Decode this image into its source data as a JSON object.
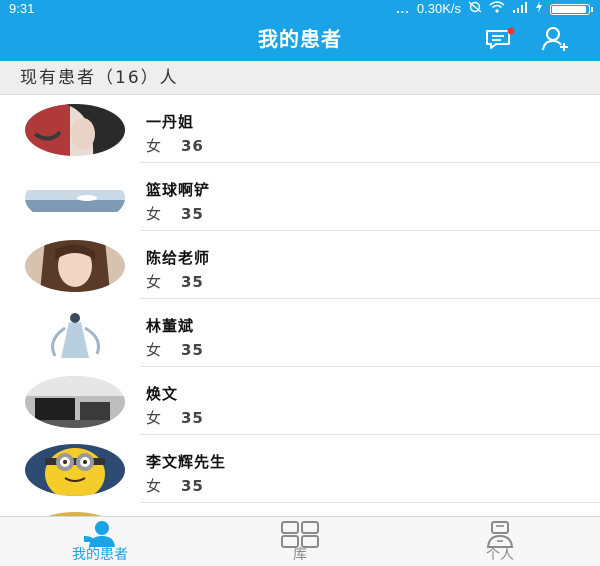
{
  "status_bar": {
    "time": "9:31",
    "signal_dots": "...",
    "network_speed": "0.30K/s"
  },
  "header": {
    "title": "我的患者",
    "message_icon": "chat-notification-icon",
    "add_icon": "add-user-icon",
    "background_color": "#1aa3e6"
  },
  "summary": {
    "text": "现有患者（16）人"
  },
  "patients": [
    {
      "name": "一丹姐",
      "gender": "女",
      "age": "36",
      "avatar": "avatar-dark-art"
    },
    {
      "name": "篮球啊铲",
      "gender": "女",
      "age": "35",
      "avatar": "avatar-sky-landscape"
    },
    {
      "name": "陈给老师",
      "gender": "女",
      "age": "35",
      "avatar": "avatar-woman-portrait"
    },
    {
      "name": "林董斌",
      "gender": "女",
      "age": "35",
      "avatar": "avatar-fairy-figure"
    },
    {
      "name": "焕文",
      "gender": "女",
      "age": "35",
      "avatar": "avatar-room-scene"
    },
    {
      "name": "李文辉先生",
      "gender": "女",
      "age": "35",
      "avatar": "avatar-minion"
    }
  ],
  "bottom_nav": [
    {
      "label": "我的患者",
      "icon": "patients-icon",
      "active": true
    },
    {
      "label": "库",
      "icon": "library-grid-icon",
      "active": false
    },
    {
      "label": "个人",
      "icon": "profile-icon",
      "active": false
    }
  ],
  "colors": {
    "accent": "#1aa3e6",
    "inactive": "#8a8a8a"
  }
}
